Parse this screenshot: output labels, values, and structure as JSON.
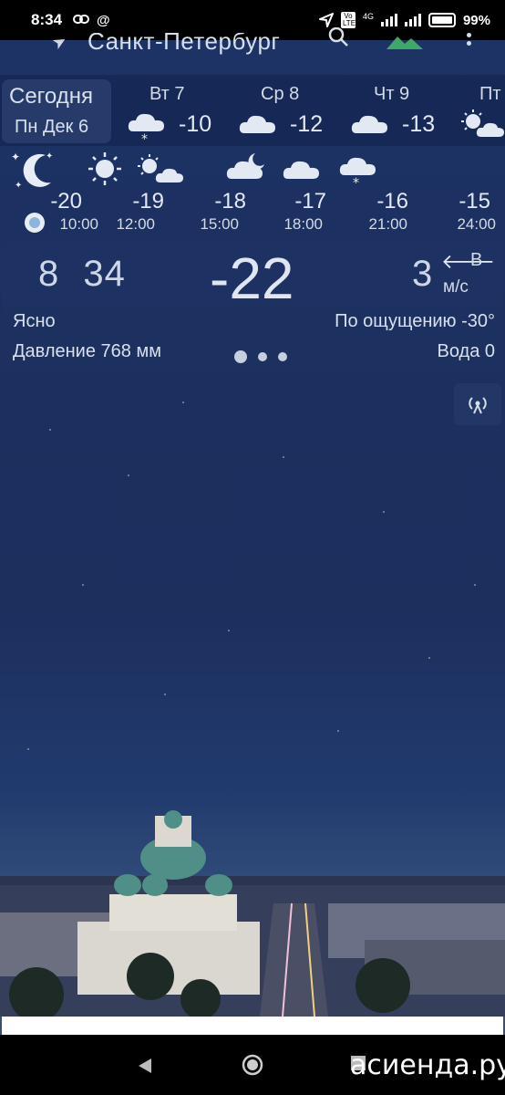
{
  "status_bar": {
    "time": "8:34",
    "icons_left": [
      "link-icon",
      "at-icon"
    ],
    "network": "4G",
    "volte": "Vo LTE",
    "battery": "99%"
  },
  "app_bar": {
    "city": "Санкт-Петербург"
  },
  "days": {
    "today_title": "Сегодня",
    "today_date": "Пн Дек 6",
    "items": [
      {
        "label": "Вт 7",
        "temp": "-10",
        "icon": "cloud-snow-icon"
      },
      {
        "label": "Ср 8",
        "temp": "-12",
        "icon": "cloud-icon"
      },
      {
        "label": "Чт 9",
        "temp": "-13",
        "icon": "cloud-icon"
      },
      {
        "label": "Пт",
        "temp": "",
        "icon": "sun-cloud-icon"
      }
    ]
  },
  "hourly": [
    {
      "temp": "-20",
      "time": "10:00",
      "icon": "moon-icon"
    },
    {
      "temp": "-19",
      "time": "12:00",
      "icon": "sun-icon"
    },
    {
      "temp": "-18",
      "time": "15:00",
      "icon": "sun-cloud-icon"
    },
    {
      "temp": "-17",
      "time": "18:00",
      "icon": "cloud-moon-icon"
    },
    {
      "temp": "-16",
      "time": "21:00",
      "icon": "cloud-icon"
    },
    {
      "temp": "-15",
      "time": "24:00",
      "icon": "cloud-snow-icon"
    }
  ],
  "current": {
    "time_hours": "8",
    "time_minutes": "34",
    "temperature": "-22",
    "wind_speed": "3",
    "wind_direction": "В",
    "wind_unit": "м/с",
    "condition": "Ясно",
    "feels_like": "По ощущению -30°",
    "pressure": "Давление 768 мм",
    "water": "Вода 0"
  },
  "watermark": "асиенда.ру",
  "colors": {
    "sky_top": "#1d3366",
    "text": "#e8edf5",
    "now_marker": "#8fb4dc"
  }
}
